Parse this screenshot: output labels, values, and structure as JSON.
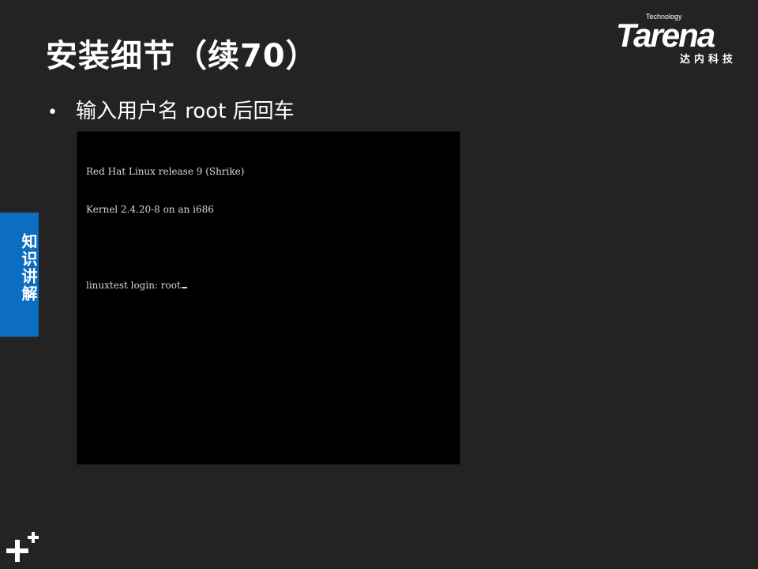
{
  "slide": {
    "title": "安装细节（续70）",
    "bullet": "输入用户名 root 后回车",
    "bullet_marker": "•"
  },
  "logo": {
    "tagline": "Technology",
    "brand": "Tarena",
    "brand_cn": "达内科技"
  },
  "terminal": {
    "lines": [
      "Red Hat Linux release 9 (Shrike)",
      "Kernel 2.4.20-8 on an i686",
      "",
      "linuxtest login: root"
    ]
  },
  "side_tab": {
    "label": "知识讲解"
  },
  "icons": {
    "corner_mark": "plus-plus-icon"
  },
  "colors": {
    "background": "#252223",
    "side_tab": "#0b6ec2",
    "terminal_bg": "#000000",
    "terminal_text": "#d8d8d8"
  }
}
